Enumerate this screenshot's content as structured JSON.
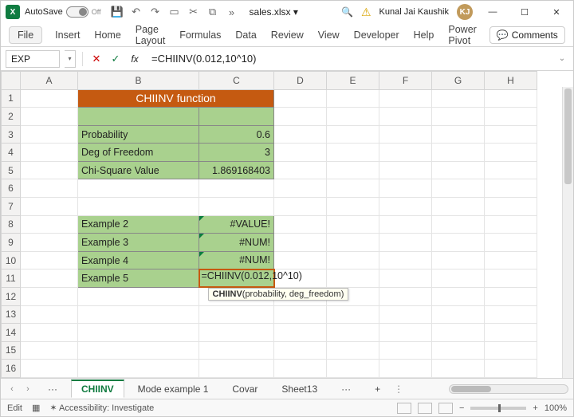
{
  "title": {
    "autosave": "AutoSave",
    "autosave_state": "Off",
    "filename": "sales.xlsx ▾",
    "search_icon": "🔍",
    "user": "Kunal Jai Kaushik",
    "user_initials": "KJ"
  },
  "ribbon": {
    "file": "File",
    "tabs": [
      "Insert",
      "Home",
      "Page Layout",
      "Formulas",
      "Data",
      "Review",
      "View",
      "Developer",
      "Help",
      "Power Pivot"
    ],
    "comments": "Comments"
  },
  "formula_bar": {
    "name_box": "EXP",
    "formula": "=CHIINV(0.012,10^10)"
  },
  "columns": [
    "A",
    "B",
    "C",
    "D",
    "E",
    "F",
    "G",
    "H"
  ],
  "rows": [
    "1",
    "2",
    "3",
    "4",
    "5",
    "6",
    "7",
    "8",
    "9",
    "10",
    "11",
    "12",
    "13",
    "14",
    "15",
    "16"
  ],
  "cells": {
    "header": "CHIINV function",
    "b3": "Probability",
    "c3": "0.6",
    "b4": "Deg of Freedom",
    "c4": "3",
    "b5": "Chi-Square Value",
    "c5": "1.869168403",
    "b8": "Example 2",
    "c8": "#VALUE!",
    "b9": "Example 3",
    "c9": "#NUM!",
    "b10": "Example 4",
    "c10": "#NUM!",
    "b11": "Example 5",
    "c11": "=CHIINV(0.012,10^10)"
  },
  "tooltip": {
    "fn": "CHIINV",
    "args": "(probability, deg_freedom)"
  },
  "sheets": {
    "dots": "···",
    "active": "CHIINV",
    "others": [
      "Mode example 1",
      "Covar",
      "Sheet13"
    ],
    "more": "···",
    "plus": "+"
  },
  "status": {
    "mode": "Edit",
    "acc": "Accessibility: Investigate",
    "zoom": "100%"
  }
}
